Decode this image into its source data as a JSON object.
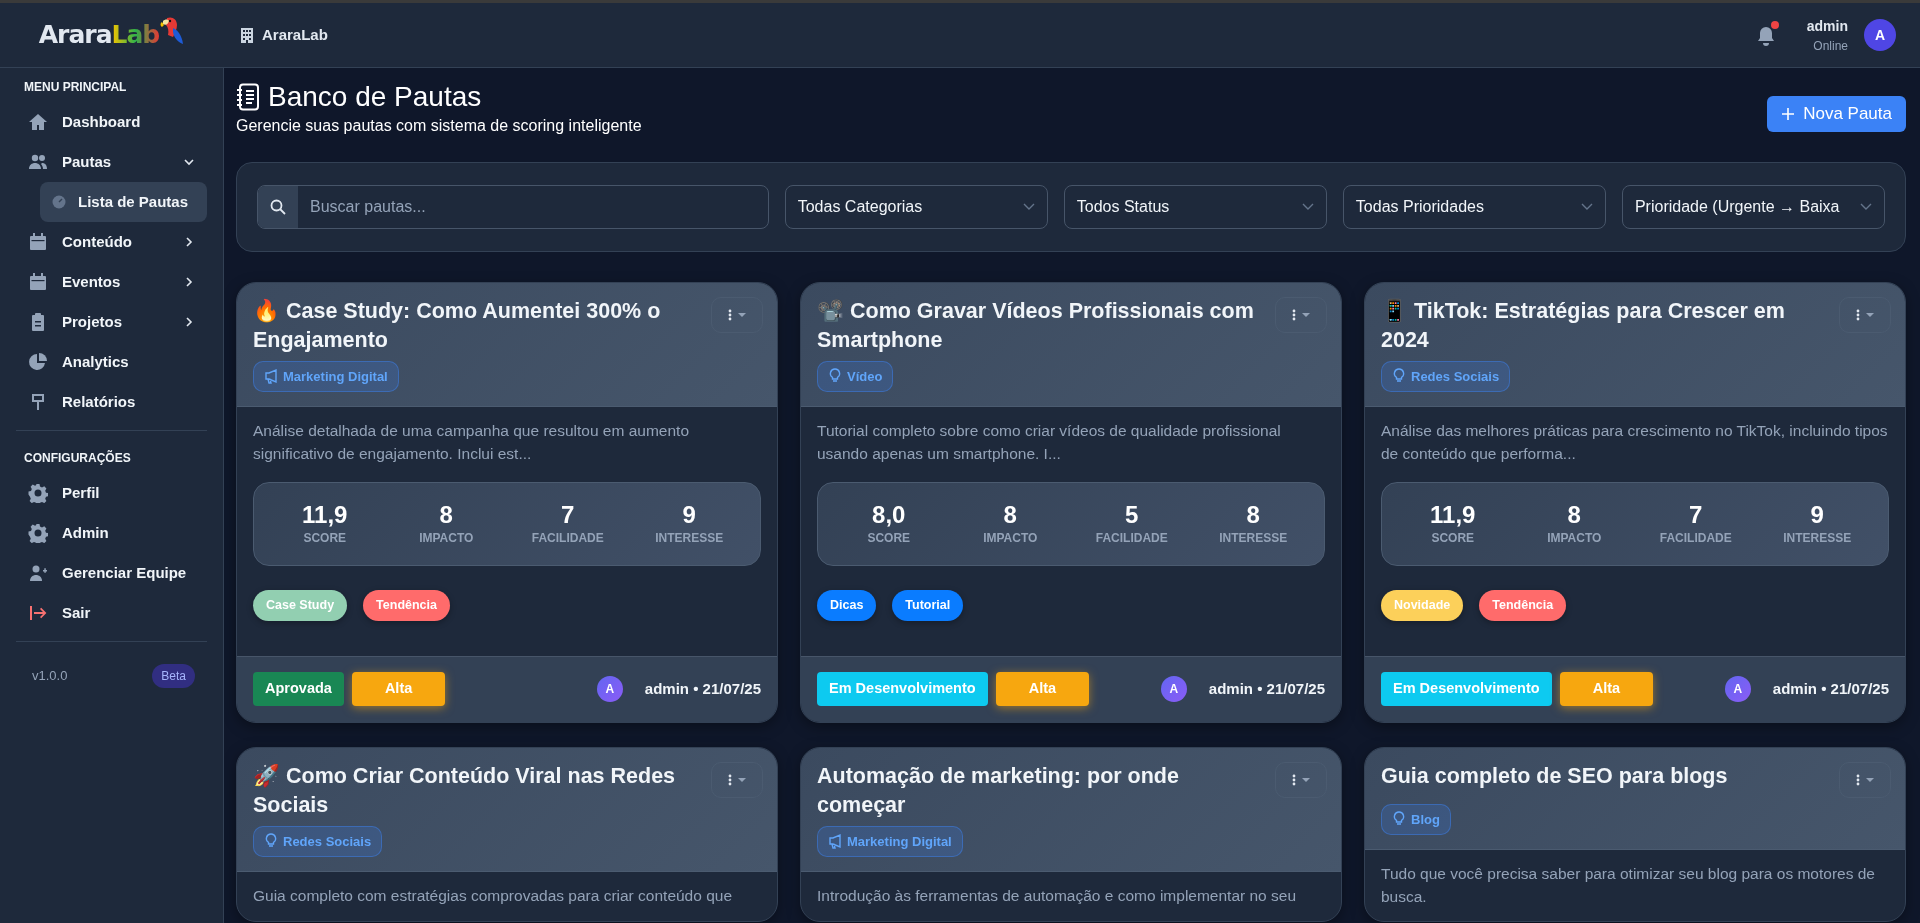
{
  "header": {
    "logo": {
      "part_1": "Arara",
      "part_2": "Lab"
    },
    "workspace": "AraraLab",
    "notifications": {
      "unread": true
    },
    "user": {
      "name": "admin",
      "status": "Online",
      "avatar": "A"
    }
  },
  "sidebar": {
    "sections": [
      {
        "title": "MENU PRINCIPAL",
        "items": [
          {
            "label": "Dashboard",
            "kind": "house",
            "selected": false
          },
          {
            "label": "Pautas",
            "kind": "people",
            "selected": false,
            "expanded": true,
            "children": [
              {
                "label": "Lista de Pautas",
                "selected": true
              }
            ]
          },
          {
            "label": "Conteúdo",
            "kind": "calendar",
            "selected": false,
            "expanded": false
          },
          {
            "label": "Eventos",
            "kind": "calendar",
            "selected": false,
            "expanded": false
          },
          {
            "label": "Projetos",
            "kind": "clipboard",
            "selected": false,
            "expanded": false
          },
          {
            "label": "Analytics",
            "kind": "pie",
            "selected": false
          },
          {
            "label": "Relatórios",
            "kind": "sign",
            "selected": false
          }
        ]
      },
      {
        "title": "CONFIGURAÇÕES",
        "items": [
          {
            "label": "Perfil",
            "kind": "gear",
            "selected": false
          },
          {
            "label": "Admin",
            "kind": "gear",
            "selected": false
          },
          {
            "label": "Gerenciar Equipe",
            "kind": "person-add",
            "selected": false
          },
          {
            "label": "Sair",
            "kind": "exit",
            "selected": false
          }
        ]
      }
    ],
    "version": "v1.0.0",
    "badge": "Beta"
  },
  "page": {
    "title": "Banco de Pautas",
    "subtitle": "Gerencie suas pautas com sistema de scoring inteligente",
    "new_button": "Nova Pauta"
  },
  "filters": {
    "search": {
      "placeholder": "Buscar pautas..."
    },
    "selects": [
      "Todas Categorias",
      "Todos Status",
      "Todas Prioridades",
      "Prioridade (Urgente → Baixa"
    ]
  },
  "cards": [
    {
      "title": "🔥 Case Study: Como Aumentei 300% o Engajamento",
      "category": {
        "label": "Marketing Digital",
        "kind": "megaphone"
      },
      "description": "Análise detalhada de uma campanha que resultou em aumento significativo de engajamento. Inclui est...",
      "stats": [
        {
          "value": "11,9",
          "label": "SCORE"
        },
        {
          "value": "8",
          "label": "IMPACTO"
        },
        {
          "value": "7",
          "label": "FACILIDADE"
        },
        {
          "value": "9",
          "label": "INTERESSE"
        }
      ],
      "tags": [
        {
          "label": "Case Study",
          "color": "#92cfb1"
        },
        {
          "label": "Tendência",
          "color": "#ff6b6b"
        }
      ],
      "status": {
        "label": "Aprovada",
        "color": "#198754"
      },
      "priority": {
        "label": "Alta",
        "color": "#f7a70f"
      },
      "author": {
        "avatar": "A",
        "text": "admin • 21/07/25"
      }
    },
    {
      "title": "📽️ Como Gravar Vídeos Profissionais com Smartphone",
      "category": {
        "label": "Vídeo",
        "kind": "bulb"
      },
      "description": "Tutorial completo sobre como criar vídeos de qualidade profissional usando apenas um smartphone. I...",
      "stats": [
        {
          "value": "8,0",
          "label": "SCORE"
        },
        {
          "value": "8",
          "label": "IMPACTO"
        },
        {
          "value": "5",
          "label": "FACILIDADE"
        },
        {
          "value": "8",
          "label": "INTERESSE"
        }
      ],
      "tags": [
        {
          "label": "Dicas",
          "color": "#0a7cff"
        },
        {
          "label": "Tutorial",
          "color": "#0a7cff"
        }
      ],
      "status": {
        "label": "Em Desenvolvimento",
        "color": "#0dcaf0"
      },
      "priority": {
        "label": "Alta",
        "color": "#f7a70f"
      },
      "author": {
        "avatar": "A",
        "text": "admin • 21/07/25"
      }
    },
    {
      "title": "📱 TikTok: Estratégias para Crescer em 2024",
      "category": {
        "label": "Redes Sociais",
        "kind": "bulb"
      },
      "description": "Análise das melhores práticas para crescimento no TikTok, incluindo tipos de conteúdo que performa...",
      "stats": [
        {
          "value": "11,9",
          "label": "SCORE"
        },
        {
          "value": "8",
          "label": "IMPACTO"
        },
        {
          "value": "7",
          "label": "FACILIDADE"
        },
        {
          "value": "9",
          "label": "INTERESSE"
        }
      ],
      "tags": [
        {
          "label": "Novidade",
          "color": "#fcd05a"
        },
        {
          "label": "Tendência",
          "color": "#ff6b6b"
        }
      ],
      "status": {
        "label": "Em Desenvolvimento",
        "color": "#0dcaf0"
      },
      "priority": {
        "label": "Alta",
        "color": "#f7a70f"
      },
      "author": {
        "avatar": "A",
        "text": "admin • 21/07/25"
      }
    },
    {
      "title": "🚀 Como Criar Conteúdo Viral nas Redes Sociais",
      "category": {
        "label": "Redes Sociais",
        "kind": "bulb"
      },
      "description": "Guia completo com estratégias comprovadas para criar conteúdo que"
    },
    {
      "title": "Automação de marketing: por onde começar",
      "category": {
        "label": "Marketing Digital",
        "kind": "megaphone"
      },
      "description": "Introdução às ferramentas de automação e como implementar no seu"
    },
    {
      "title": "Guia completo de SEO para blogs",
      "category": {
        "label": "Blog",
        "kind": "bulb"
      },
      "description": "Tudo que você precisa saber para otimizar seu blog para os motores de busca."
    }
  ]
}
